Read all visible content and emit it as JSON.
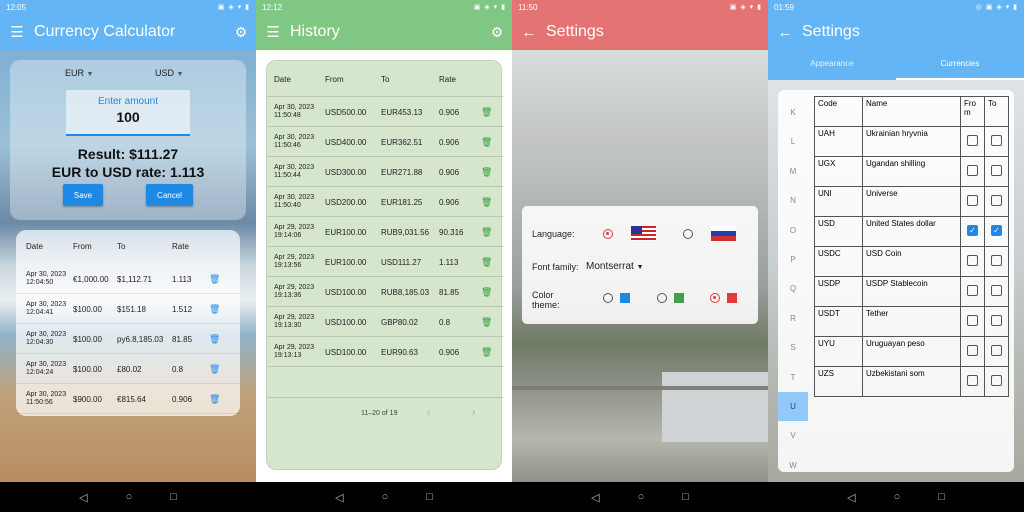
{
  "screen1": {
    "status_time": "12:05",
    "title": "Currency Calculator",
    "from_currency": "EUR",
    "to_currency": "USD",
    "amount_label": "Enter amount",
    "amount_value": "100",
    "result": "Result: $111.27",
    "rate": "EUR to USD rate: 1.113",
    "save_label": "Save",
    "cancel_label": "Cancel",
    "headers": [
      "Date",
      "From",
      "To",
      "Rate"
    ],
    "rows": [
      {
        "date": "Apr 30, 2023",
        "time": "12:04:50",
        "from": "€1,000.00",
        "to": "$1,112.71",
        "rate": "1.113"
      },
      {
        "date": "Apr 30, 2023",
        "time": "12:04:41",
        "from": "$100.00",
        "to": "$151.18",
        "rate": "1.512"
      },
      {
        "date": "Apr 30, 2023",
        "time": "12:04:30",
        "from": "$100.00",
        "to": "py6.8,185.03",
        "rate": "81.85"
      },
      {
        "date": "Apr 30, 2023",
        "time": "12:04:24",
        "from": "$100.00",
        "to": "£80.02",
        "rate": "0.8"
      },
      {
        "date": "Apr 30, 2023",
        "time": "11:50:56",
        "from": "$900.00",
        "to": "€815.64",
        "rate": "0.906"
      }
    ]
  },
  "screen2": {
    "status_time": "12:12",
    "title": "History",
    "headers": [
      "Date",
      "From",
      "To",
      "Rate"
    ],
    "rows": [
      {
        "date": "Apr 30, 2023",
        "time": "11:50:48",
        "from": "USD500.00",
        "to": "EUR453.13",
        "rate": "0.906"
      },
      {
        "date": "Apr 30, 2023",
        "time": "11:50:46",
        "from": "USD400.00",
        "to": "EUR362.51",
        "rate": "0.906"
      },
      {
        "date": "Apr 30, 2023",
        "time": "11:50:44",
        "from": "USD300.00",
        "to": "EUR271.88",
        "rate": "0.906"
      },
      {
        "date": "Apr 30, 2023",
        "time": "11:50:40",
        "from": "USD200.00",
        "to": "EUR181.25",
        "rate": "0.906"
      },
      {
        "date": "Apr 29, 2023",
        "time": "19:14:06",
        "from": "EUR100.00",
        "to": "RUB9,031.56",
        "rate": "90.316"
      },
      {
        "date": "Apr 29, 2023",
        "time": "19:13:56",
        "from": "EUR100.00",
        "to": "USD111.27",
        "rate": "1.113"
      },
      {
        "date": "Apr 29, 2023",
        "time": "19:13:36",
        "from": "USD100.00",
        "to": "RUB8,185.03",
        "rate": "81.85"
      },
      {
        "date": "Apr 29, 2023",
        "time": "19:13:30",
        "from": "USD100.00",
        "to": "GBP80.02",
        "rate": "0.8"
      },
      {
        "date": "Apr 29, 2023",
        "time": "19:13:13",
        "from": "USD100.00",
        "to": "EUR90.63",
        "rate": "0.906"
      }
    ],
    "pagination": "11–20 of 19"
  },
  "screen3": {
    "status_time": "11:50",
    "title": "Settings",
    "language_label": "Language:",
    "font_label": "Font family:",
    "font_value": "Montserrat",
    "color_label": "Color theme:"
  },
  "screen4": {
    "status_time": "01:59",
    "title": "Settings",
    "tab_appearance": "Appearance",
    "tab_currencies": "Currencies",
    "letters": [
      "K",
      "L",
      "M",
      "N",
      "O",
      "P",
      "Q",
      "R",
      "S",
      "T",
      "U",
      "V",
      "W"
    ],
    "headers": {
      "code": "Code",
      "name": "Name",
      "from": "Fro m",
      "to": "To"
    },
    "rows": [
      {
        "code": "UAH",
        "name": "Ukrainian hryvnia",
        "from": false,
        "to": false
      },
      {
        "code": "UGX",
        "name": "Ugandan shilling",
        "from": false,
        "to": false
      },
      {
        "code": "UNI",
        "name": "Universe",
        "from": false,
        "to": false
      },
      {
        "code": "USD",
        "name": "United States dollar",
        "from": true,
        "to": true
      },
      {
        "code": "USDC",
        "name": "USD Coin",
        "from": false,
        "to": false
      },
      {
        "code": "USDP",
        "name": "USDP Stablecoin",
        "from": false,
        "to": false
      },
      {
        "code": "USDT",
        "name": "Tether",
        "from": false,
        "to": false
      },
      {
        "code": "UYU",
        "name": "Uruguayan peso",
        "from": false,
        "to": false
      },
      {
        "code": "UZS",
        "name": "Uzbekistani som",
        "from": false,
        "to": false
      }
    ]
  },
  "colors": {
    "blue": "#64b5f6",
    "green": "#81c784",
    "red": "#e57373",
    "accent_blue": "#1e88e5",
    "accent_green": "#2e9b3a",
    "accent_red": "#e53935"
  },
  "icons": [
    "menu-icon",
    "gear-icon",
    "back-arrow-icon",
    "trash-icon",
    "chevron-left-icon",
    "chevron-right-icon",
    "dropdown-icon"
  ]
}
